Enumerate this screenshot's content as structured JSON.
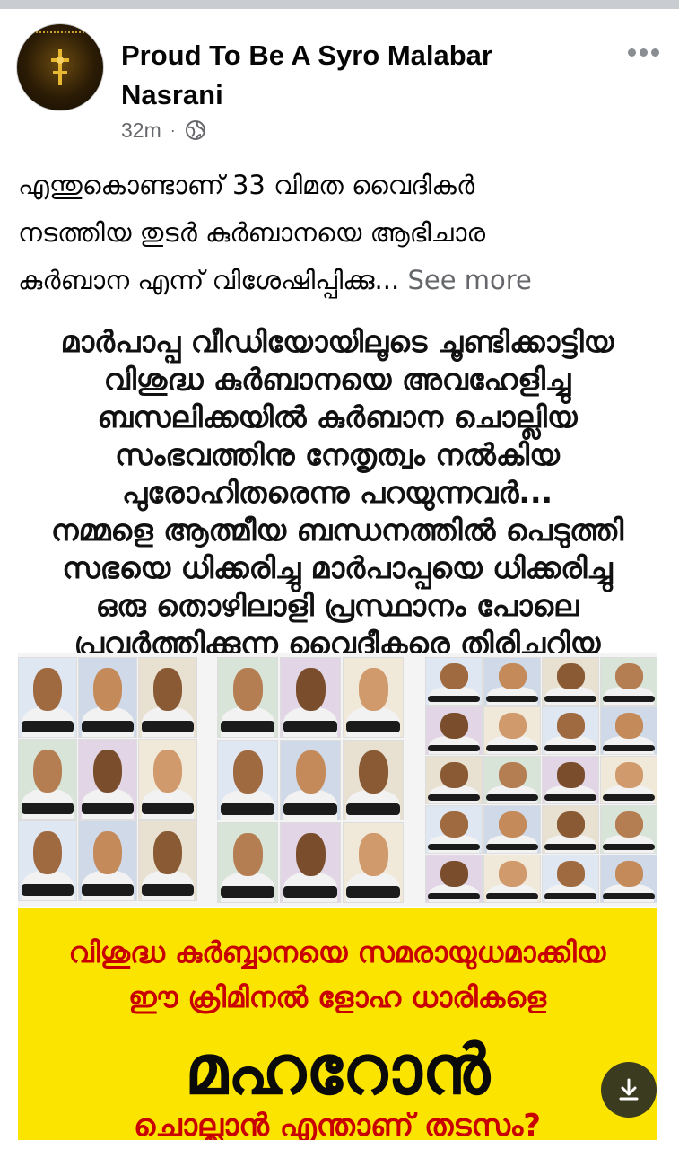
{
  "post": {
    "page_name": "Proud To Be A Syro Malabar Nasrani",
    "time": "32m",
    "separator": "·",
    "privacy_icon": "globe-icon",
    "more_icon": "more-horizontal-icon",
    "caption_lines": [
      "എന്തുകൊണ്ടാണ് 33 വിമത വൈദികർ",
      "നടത്തിയ തുടർ കുർബാനയെ ആഭിചാര",
      "കുർബാന എന്ന് വിശേഷിപ്പിക്കു..."
    ],
    "see_more": "See more"
  },
  "poster": {
    "headline_lines": [
      "മാർപാപ്പ വീഡിയോയിലൂടെ ചൂണ്ടിക്കാട്ടിയ",
      "വിശുദ്ധ കുർബാനയെ അവഹേളിച്ചു",
      "ബസലിക്കയിൽ കുർബാന ചൊല്ലിയ",
      "സംഭവത്തിനു നേതൃത്വം നൽകിയ",
      "പുരോഹിതരെന്നു പറയുന്നവർ...",
      "നമ്മളെ ആത്മീയ ബന്ധനത്തിൽ പെടുത്തി",
      "സഭയെ ധിക്കരിച്ചു മാർപാപ്പയെ ധിക്കരിച്ചു",
      "ഒരു തൊഴിലാളി പ്രസ്ഥാനം പോലെ",
      "പ്രവർത്തിക്കുന്ന വൈദീകരെ തിരിച്ചറിയൂ"
    ],
    "banner_lines": [
      "വിശുദ്ധ കുർബ്ബാനയെ സമരായുധമാക്കിയ",
      "ഈ ക്രിമിനൽ ളോഹ ധാരികളെ"
    ],
    "banner_big": "മഹറോൻ",
    "banner_bottom": "ചൊല്ലാൻ എന്താണ് തടസം?",
    "colors": {
      "banner_bg": "#fbe400",
      "banner_text": "#c80000"
    }
  },
  "download_icon": "download-icon"
}
